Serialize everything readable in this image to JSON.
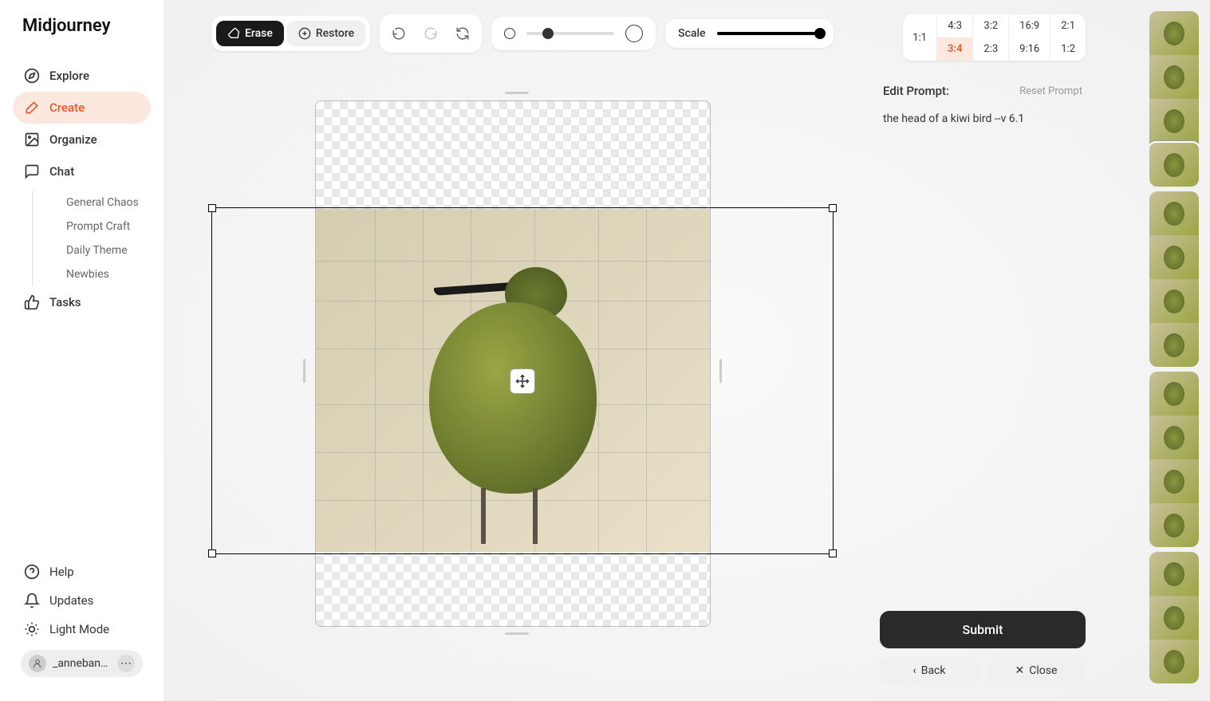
{
  "app": {
    "name": "Midjourney"
  },
  "sidebar": {
    "items": [
      {
        "label": "Explore",
        "icon": "compass-icon"
      },
      {
        "label": "Create",
        "icon": "brush-icon",
        "active": true
      },
      {
        "label": "Organize",
        "icon": "image-icon"
      },
      {
        "label": "Chat",
        "icon": "chat-icon"
      },
      {
        "label": "Tasks",
        "icon": "thumbs-up-icon"
      }
    ],
    "chat_subitems": [
      {
        "label": "General Chaos"
      },
      {
        "label": "Prompt Craft"
      },
      {
        "label": "Daily Theme"
      },
      {
        "label": "Newbies"
      }
    ],
    "bottom": [
      {
        "label": "Help",
        "icon": "help-icon"
      },
      {
        "label": "Updates",
        "icon": "bell-icon"
      },
      {
        "label": "Light Mode",
        "icon": "sun-icon"
      }
    ],
    "user": {
      "name": "_anneban…"
    }
  },
  "toolbar": {
    "erase_label": "Erase",
    "restore_label": "Restore",
    "scale_label": "Scale",
    "brush_value": 20,
    "scale_value": 100
  },
  "aspect_ratios": {
    "fixed": "1:1",
    "row1": [
      "4:3",
      "3:2",
      "16:9",
      "2:1"
    ],
    "row2": [
      "3:4",
      "2:3",
      "9:16",
      "1:2"
    ],
    "active": "3:4"
  },
  "prompt_panel": {
    "title": "Edit Prompt:",
    "reset_label": "Reset Prompt",
    "prompt_text": "the head of a kiwi bird --v 6.1",
    "submit_label": "Submit",
    "back_label": "Back",
    "close_label": "Close"
  },
  "thumbnails": {
    "groups": [
      {
        "count": 4,
        "selected_index": 3
      },
      {
        "count": 4
      },
      {
        "count": 4
      },
      {
        "count": 3
      }
    ]
  }
}
